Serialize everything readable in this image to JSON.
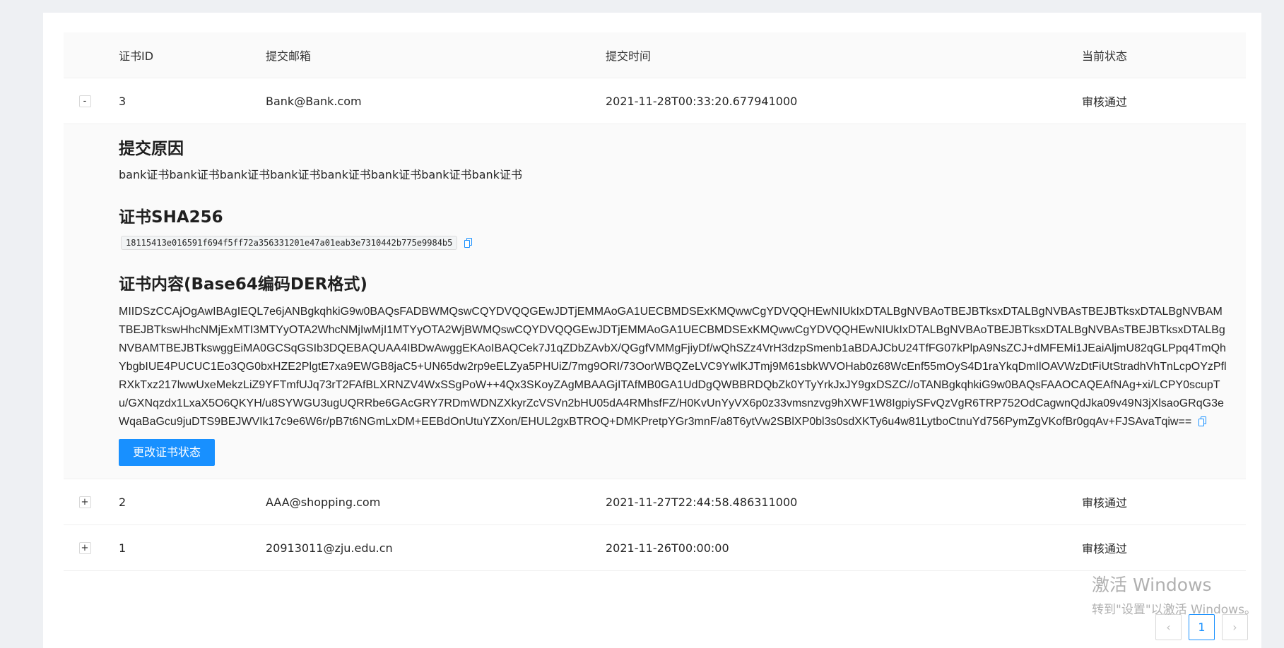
{
  "table": {
    "headers": {
      "id": "证书ID",
      "email": "提交邮箱",
      "time": "提交时间",
      "status": "当前状态"
    },
    "rows": [
      {
        "expand": "-",
        "id": "3",
        "email": "Bank@Bank.com",
        "time": "2021-11-28T00:33:20.677941000",
        "status": "审核通过"
      },
      {
        "expand": "+",
        "id": "2",
        "email": "AAA@shopping.com",
        "time": "2021-11-27T22:44:58.486311000",
        "status": "审核通过"
      },
      {
        "expand": "+",
        "id": "1",
        "email": "20913011@zju.edu.cn",
        "time": "2021-11-26T00:00:00",
        "status": "审核通过"
      }
    ]
  },
  "detail": {
    "reason_title": "提交原因",
    "reason_text": "bank证书bank证书bank证书bank证书bank证书bank证书bank证书bank证书",
    "sha_title": "证书SHA256",
    "sha_value": "18115413e016591f694f5ff72a356331201e47a01eab3e7310442b775e9984b5",
    "content_title": "证书内容(Base64编码DER格式)",
    "content_value": "MIIDSzCCAjOgAwIBAgIEQL7e6jANBgkqhkiG9w0BAQsFADBWMQswCQYDVQQGEwJDTjEMMAoGA1UECBMDSExKMQwwCgYDVQQHEwNIUkIxDTALBgNVBAoTBEJBTksxDTALBgNVBAsTBEJBTksxDTALBgNVBAMTBEJBTkswHhcNMjExMTI3MTYyOTA2WhcNMjIwMjI1MTYyOTA2WjBWMQswCQYDVQQGEwJDTjEMMAoGA1UECBMDSExKMQwwCgYDVQQHEwNIUkIxDTALBgNVBAoTBEJBTksxDTALBgNVBAsTBEJBTksxDTALBgNVBAMTBEJBTkswggEiMA0GCSqGSIb3DQEBAQUAA4IBDwAwggEKAoIBAQCek7J1qZDbZAvbX/QGgfVMMgFjiyDf/wQhSZz4VrH3dzpSmenb1aBDAJCbU24TfFG07kPlpA9NsZCJ+dMFEMi1JEaiAljmU82qGLPpq4TmQhYbgbIUE4PUCUC1Eo3QG0bxHZE2PlgtE7xa9EWGB8jaC5+UN65dw2rp9eELZya5PHUiZ/7mg9ORI/73OorWBQZeLVC9YwlKJTmj9M61sbkWVOHab0z68WcEnf55mOyS4D1raYkqDmIlOAVWzDtFiUtStradhVhTnLcpOYzPflRXkTxz217lwwUxeMekzLiZ9YFTmfUJq73rT2FAfBLXRNZV4WxSSgPoW++4Qx3SKoyZAgMBAAGjITAfMB0GA1UdDgQWBBRDQbZk0YTyYrkJxJY9gxDSZC//oTANBgkqhkiG9w0BAQsFAAOCAQEAfNAg+xi/LCPY0scupTu/GXNqzdx1LxaX5O6QKYH/u8SYWGU3ugUQRRbe6GAcGRY7RDmWDNZXkyrZcVSVn2bHU05dA4RMhsfFZ/H0KvUnYyVX6p0z33vmsnzvg9hXWF1W8IgpiySFvQzVgR6TRP752OdCagwnQdJka09v49N3jXlsaoGRqG3eWqaBaGcu9juDTS9BEJWVIk17c9e6W6r/pB7t6NGmLxDM+EEBdOnUtuYZXon/EHUL2gxBTROQ+DMKPretpYGr3mnF/a8T6ytVw2SBlXP0bl3s0sdXKTy6u4w81LytboCtnuYd756PymZgVKofBr0gqAv+FJSAvaTqiw==",
    "change_button": "更改证书状态"
  },
  "pagination": {
    "prev": "‹",
    "current": "1",
    "next": "›"
  },
  "watermark": {
    "line1": "激活 Windows",
    "line2": "转到\"设置\"以激活 Windows。"
  },
  "colors": {
    "primary": "#1890ff",
    "background": "#eef0f3"
  }
}
